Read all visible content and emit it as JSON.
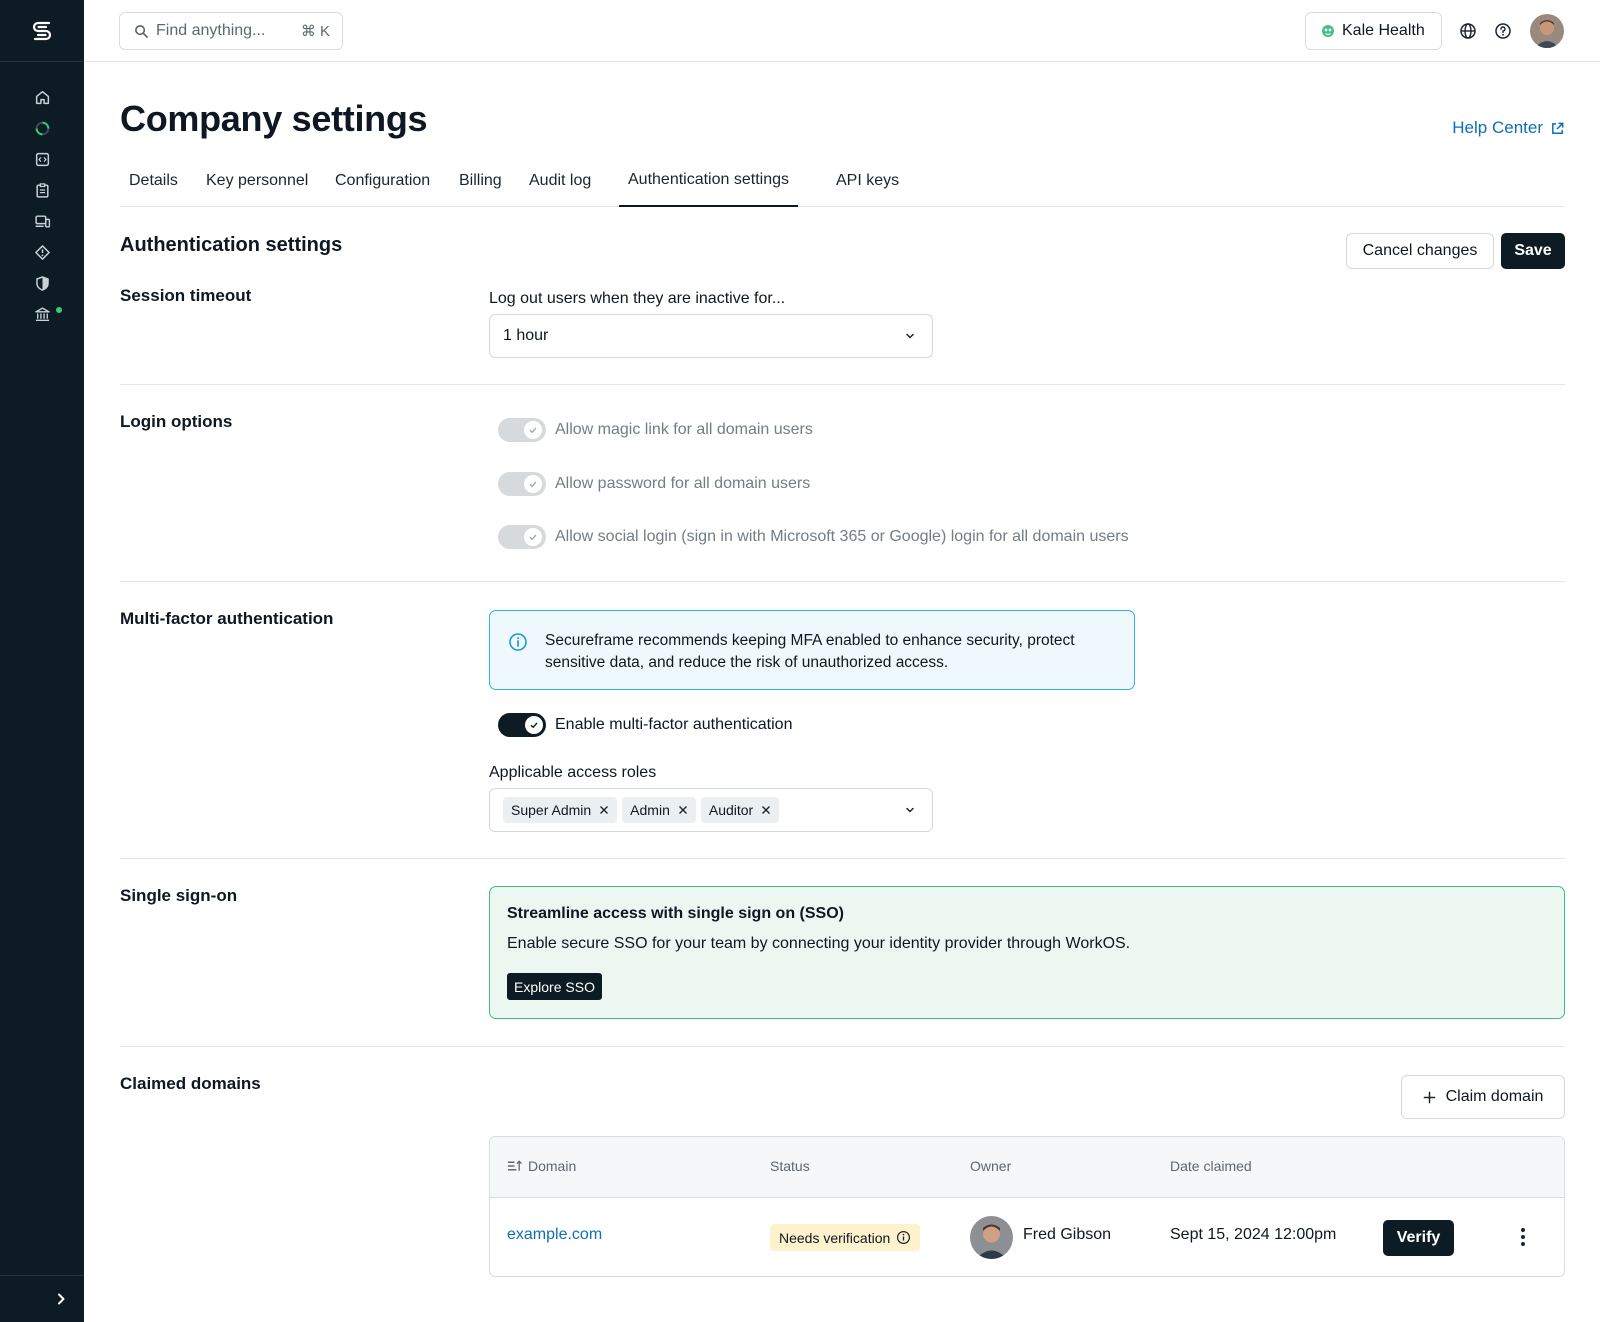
{
  "topbar": {
    "search_placeholder": "Find anything...",
    "search_shortcut": "⌘ K",
    "company_name": "Kale Health"
  },
  "page": {
    "title": "Company settings",
    "help_link": "Help Center"
  },
  "tabs": [
    {
      "label": "Details"
    },
    {
      "label": "Key personnel"
    },
    {
      "label": "Configuration"
    },
    {
      "label": "Billing"
    },
    {
      "label": "Audit log"
    },
    {
      "label": "Authentication settings",
      "active": true
    },
    {
      "label": "API keys"
    }
  ],
  "section": {
    "title": "Authentication settings",
    "cancel_label": "Cancel changes",
    "save_label": "Save"
  },
  "session_timeout": {
    "label": "Session timeout",
    "field_label": "Log out users when they are inactive for...",
    "value": "1 hour"
  },
  "login_options": {
    "label": "Login options",
    "options": [
      {
        "label": "Allow magic link for all domain users",
        "enabled": true,
        "disabled": true
      },
      {
        "label": "Allow password for all domain users",
        "enabled": true,
        "disabled": true
      },
      {
        "label": "Allow social login (sign in with Microsoft 365 or Google) login for all domain users",
        "enabled": true,
        "disabled": true
      }
    ]
  },
  "mfa": {
    "label": "Multi-factor authentication",
    "info": "Secureframe recommends keeping MFA enabled to enhance security, protect sensitive data, and reduce the risk of unauthorized access.",
    "toggle_label": "Enable multi-factor authentication",
    "enabled": true,
    "roles_label": "Applicable access roles",
    "roles": [
      "Super Admin",
      "Admin",
      "Auditor"
    ]
  },
  "sso": {
    "label": "Single sign-on",
    "title": "Streamline access with single sign on (SSO)",
    "description": "Enable secure SSO for your team by connecting your identity provider through WorkOS.",
    "button": "Explore SSO"
  },
  "domains": {
    "label": "Claimed domains",
    "claim_button": "Claim domain",
    "columns": [
      "Domain",
      "Status",
      "Owner",
      "Date claimed"
    ],
    "rows": [
      {
        "domain": "example.com",
        "status": "Needs verification",
        "owner": "Fred Gibson",
        "date": "Sept 15, 2024 12:00pm",
        "action": "Verify"
      }
    ]
  },
  "colors": {
    "sidebar_bg": "#0d1b24",
    "accent_link": "#0d6fb8",
    "status_dot": "#2fd07c",
    "info_border": "#2fb3e6",
    "sso_border": "#3fbf7f",
    "badge_bg": "#fdf2cc"
  },
  "icons": {
    "sidebar": [
      "home-icon",
      "progress-icon",
      "code-icon",
      "clipboard-icon",
      "devices-icon",
      "diamond-icon",
      "shield-icon",
      "bank-icon"
    ]
  }
}
